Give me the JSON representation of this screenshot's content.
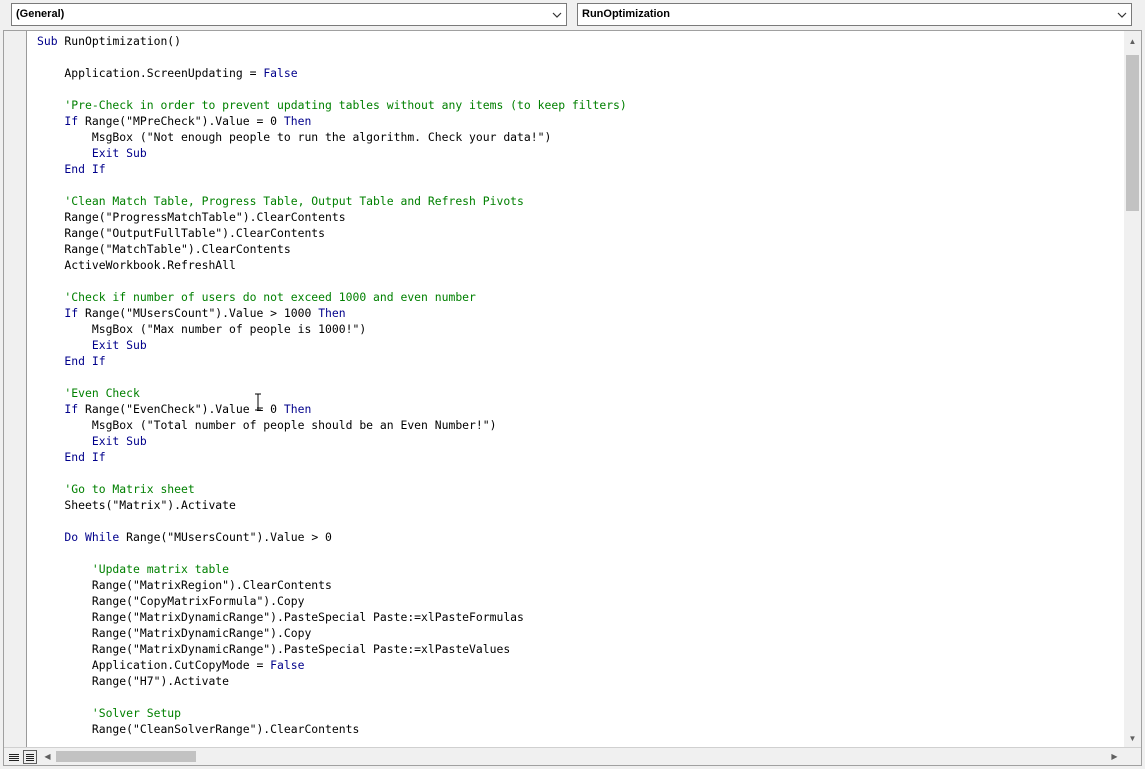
{
  "object_combo": {
    "value": "(General)",
    "icon": "chevron-down-icon"
  },
  "procedure_combo": {
    "value": "RunOptimization",
    "icon": "chevron-down-icon"
  },
  "code_lines": [
    [
      {
        "t": "kw",
        "v": "Sub"
      },
      {
        "t": "n",
        "v": " RunOptimization()"
      }
    ],
    [],
    [
      {
        "t": "n",
        "v": "    Application.ScreenUpdating = "
      },
      {
        "t": "kw",
        "v": "False"
      }
    ],
    [],
    [
      {
        "t": "cm",
        "v": "    'Pre-Check in order to prevent updating tables without any items (to keep filters)"
      }
    ],
    [
      {
        "t": "kw",
        "v": "    If"
      },
      {
        "t": "n",
        "v": " Range(\"MPreCheck\").Value = 0 "
      },
      {
        "t": "kw",
        "v": "Then"
      }
    ],
    [
      {
        "t": "n",
        "v": "        MsgBox (\"Not enough people to run the algorithm. Check your data!\")"
      }
    ],
    [
      {
        "t": "kw",
        "v": "        Exit Sub"
      }
    ],
    [
      {
        "t": "kw",
        "v": "    End If"
      }
    ],
    [],
    [
      {
        "t": "cm",
        "v": "    'Clean Match Table, Progress Table, Output Table and Refresh Pivots"
      }
    ],
    [
      {
        "t": "n",
        "v": "    Range(\"ProgressMatchTable\").ClearContents"
      }
    ],
    [
      {
        "t": "n",
        "v": "    Range(\"OutputFullTable\").ClearContents"
      }
    ],
    [
      {
        "t": "n",
        "v": "    Range(\"MatchTable\").ClearContents"
      }
    ],
    [
      {
        "t": "n",
        "v": "    ActiveWorkbook.RefreshAll"
      }
    ],
    [],
    [
      {
        "t": "cm",
        "v": "    'Check if number of users do not exceed 1000 and even number"
      }
    ],
    [
      {
        "t": "kw",
        "v": "    If"
      },
      {
        "t": "n",
        "v": " Range(\"MUsersCount\").Value > 1000 "
      },
      {
        "t": "kw",
        "v": "Then"
      }
    ],
    [
      {
        "t": "n",
        "v": "        MsgBox (\"Max number of people is 1000!\")"
      }
    ],
    [
      {
        "t": "kw",
        "v": "        Exit Sub"
      }
    ],
    [
      {
        "t": "kw",
        "v": "    End If"
      }
    ],
    [],
    [
      {
        "t": "cm",
        "v": "    'Even Check"
      }
    ],
    [
      {
        "t": "kw",
        "v": "    If"
      },
      {
        "t": "n",
        "v": " Range(\"EvenCheck\").Value = 0 "
      },
      {
        "t": "kw",
        "v": "Then"
      }
    ],
    [
      {
        "t": "n",
        "v": "        MsgBox (\"Total number of people should be an Even Number!\")"
      }
    ],
    [
      {
        "t": "kw",
        "v": "        Exit Sub"
      }
    ],
    [
      {
        "t": "kw",
        "v": "    End If"
      }
    ],
    [],
    [
      {
        "t": "cm",
        "v": "    'Go to Matrix sheet"
      }
    ],
    [
      {
        "t": "n",
        "v": "    Sheets(\"Matrix\").Activate"
      }
    ],
    [],
    [
      {
        "t": "kw",
        "v": "    Do While"
      },
      {
        "t": "n",
        "v": " Range(\"MUsersCount\").Value > 0"
      }
    ],
    [],
    [
      {
        "t": "cm",
        "v": "        'Update matrix table"
      }
    ],
    [
      {
        "t": "n",
        "v": "        Range(\"MatrixRegion\").ClearContents"
      }
    ],
    [
      {
        "t": "n",
        "v": "        Range(\"CopyMatrixFormula\").Copy"
      }
    ],
    [
      {
        "t": "n",
        "v": "        Range(\"MatrixDynamicRange\").PasteSpecial Paste:=xlPasteFormulas"
      }
    ],
    [
      {
        "t": "n",
        "v": "        Range(\"MatrixDynamicRange\").Copy"
      }
    ],
    [
      {
        "t": "n",
        "v": "        Range(\"MatrixDynamicRange\").PasteSpecial Paste:=xlPasteValues"
      }
    ],
    [
      {
        "t": "n",
        "v": "        Application.CutCopyMode = "
      },
      {
        "t": "kw",
        "v": "False"
      }
    ],
    [
      {
        "t": "n",
        "v": "        Range(\"H7\").Activate"
      }
    ],
    [],
    [
      {
        "t": "cm",
        "v": "        'Solver Setup"
      }
    ],
    [
      {
        "t": "n",
        "v": "        Range(\"CleanSolverRange\").ClearContents"
      }
    ]
  ],
  "colors": {
    "keyword": "#00008b",
    "comment": "#008000",
    "text": "#000000"
  }
}
